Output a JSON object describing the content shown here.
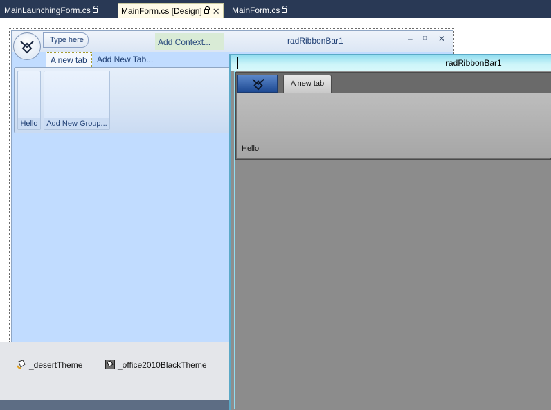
{
  "doc_tabs": [
    {
      "label": "MainLaunchingForm.cs",
      "locked": true,
      "active": false
    },
    {
      "label": "MainForm.cs [Design]",
      "locked": true,
      "active": true
    },
    {
      "label": "MainForm.cs",
      "locked": true,
      "active": false
    }
  ],
  "close_glyph": "✕",
  "designer_form": {
    "caption": "radRibbonBar1",
    "quick_access_placeholder": "Type here",
    "context_tab": "Add Context...",
    "tabs": [
      "A new tab",
      "Add New Tab..."
    ],
    "groups": [
      "Hello",
      "Add New Group..."
    ],
    "window_controls": [
      "–",
      "□",
      "✕"
    ]
  },
  "tray": {
    "items": [
      "_desertTheme",
      "_office2010BlackTheme"
    ]
  },
  "preview_form": {
    "caption": "radRibbonBar1",
    "tab": "A new tab",
    "group": "Hello"
  },
  "colors": {
    "title_bar": "#293955",
    "designer_blue": "#c1dcff",
    "preview_dark": "#8e8e8e",
    "preview_title": "#8fdcef",
    "active_tab": "#fffbe8"
  }
}
